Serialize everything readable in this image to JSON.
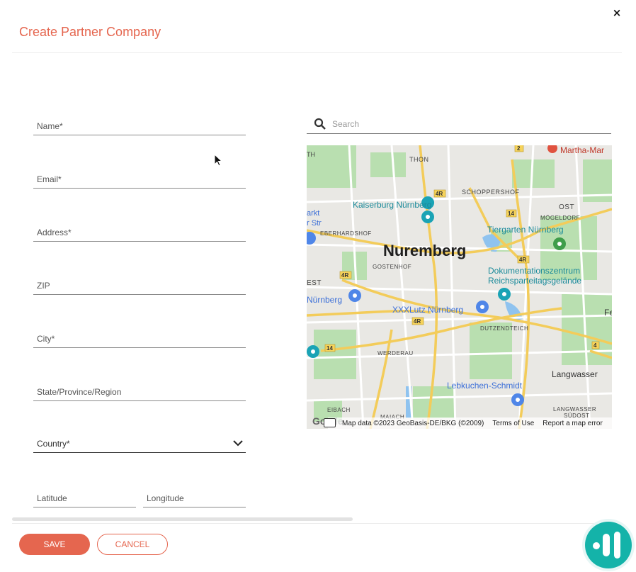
{
  "dialog": {
    "title": "Create Partner Company",
    "close_label": "×"
  },
  "form": {
    "name": "Name*",
    "email": "Email*",
    "address": "Address*",
    "zip": "ZIP",
    "city": "City*",
    "state": "State/Province/Region",
    "country": "Country*",
    "latitude": "Latitude",
    "longitude": "Longitude"
  },
  "map_search": {
    "placeholder": "Search"
  },
  "map": {
    "city_label": "Nuremberg",
    "places": {
      "kaiserburg": "Kaiserburg Nürnberg",
      "tiergarten": "Tiergarten Nürnberg",
      "doku_1": "Dokumentationszentrum",
      "doku_2": "Reichsparteitagsgelände",
      "xxxlutz": "XXXLutz Nürnberg",
      "lebkuchen": "Lebkuchen-Schmidt",
      "martha": "Martha-Mar",
      "nurnberg_left": "Nürnberg",
      "markt": "arkt",
      "str": "r Str"
    },
    "districts": {
      "thon": "THON",
      "schoppershof": "SCHOPPERSHOF",
      "ost": "OST",
      "mogeldorf": "MÖGELDORF",
      "eberhardshof": "EBERHARDSHOF",
      "gostenhof": "GOSTENHOF",
      "est": "EST",
      "dutzendteich": "DUTZENDTEICH",
      "werderau": "WERDERAU",
      "langwasser": "Langwasser",
      "langwasser_sud_1": "LANGWASSER",
      "langwasser_sud_2": "SÜDOST",
      "eibach": "EIBACH",
      "maiach": "MAIACH",
      "th": "TH",
      "fe": "Fe"
    },
    "road_shields": [
      "2",
      "4R",
      "14",
      "4R",
      "4R",
      "4R",
      "14",
      "4"
    ],
    "attribution": {
      "data": "Map data ©2023 GeoBasis-DE/BKG (©2009)",
      "terms": "Terms of Use",
      "report": "Report a map error"
    },
    "google_logo": "Go gle"
  },
  "actions": {
    "save": "SAVE",
    "cancel": "CANCEL"
  },
  "colors": {
    "accent": "#e5664f",
    "teal": "#14b3a9",
    "map_bg": "#e9e8e4",
    "park": "#b9dfb0",
    "road": "#f3cc5a",
    "water": "#8fc3ef"
  }
}
